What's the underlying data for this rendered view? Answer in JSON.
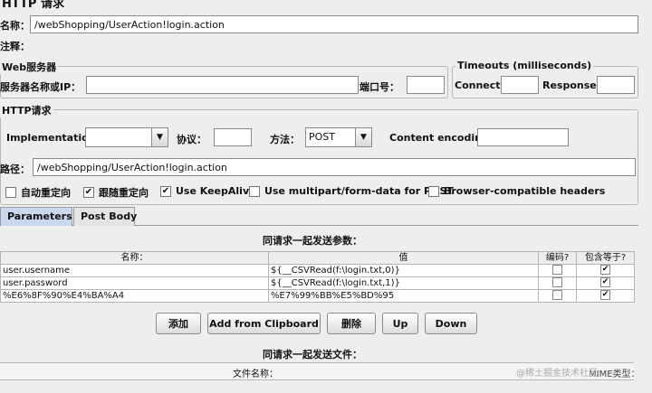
{
  "panel": {
    "title": "HTTP 请求"
  },
  "name": {
    "label": "名称：",
    "value": "/webShopping/UserAction!login.action"
  },
  "comment": {
    "label": "注释："
  },
  "web_server": {
    "title": "Web服务器",
    "server_label": "服务器名称或IP：",
    "server_value": "",
    "port_label": "端口号：",
    "port_value": ""
  },
  "timeouts": {
    "title": "Timeouts (milliseconds)",
    "connect_label": "Connect:",
    "connect_value": "",
    "response_label": "Response:",
    "response_value": ""
  },
  "http_request": {
    "title": "HTTP请求",
    "implementation_label": "Implementation:",
    "implementation_value": "",
    "protocol_label": "协议：",
    "protocol_value": "",
    "method_label": "方法：",
    "method_value": "POST",
    "encoding_label": "Content encoding:",
    "encoding_value": "",
    "path_label": "路径：",
    "path_value": "/webShopping/UserAction!login.action"
  },
  "options": [
    {
      "label": "自动重定向",
      "checked": false
    },
    {
      "label": "跟随重定向",
      "checked": true
    },
    {
      "label": "Use KeepAlive",
      "checked": true
    },
    {
      "label": "Use multipart/form-data for POST",
      "checked": false
    },
    {
      "label": "Browser-compatible headers",
      "checked": false
    }
  ],
  "tabs": {
    "parameters": "Parameters",
    "post_body": "Post Body"
  },
  "params": {
    "title": "同请求一起发送参数：",
    "headers": [
      "名称：",
      "值",
      "编码?",
      "包含等于?"
    ],
    "rows": [
      {
        "name": "user.username",
        "value": "${__CSVRead(f:\\login.txt,0)}",
        "encode": false,
        "include_equals": true
      },
      {
        "name": "user.password",
        "value": "${__CSVRead(f:\\login.txt,1)}",
        "encode": false,
        "include_equals": true
      },
      {
        "name": "%E6%8F%90%E4%BA%A4",
        "value": "%E7%99%BB%E5%BD%95",
        "encode": false,
        "include_equals": true
      }
    ]
  },
  "buttons": {
    "add": "添加",
    "clipboard": "Add from Clipboard",
    "delete": "删除",
    "up": "Up",
    "down": "Down"
  },
  "files": {
    "title": "同请求一起发送文件：",
    "filename_header": "文件名称：",
    "mime_header": "MIME类型："
  },
  "watermark": "@稀土掘金技术社区"
}
